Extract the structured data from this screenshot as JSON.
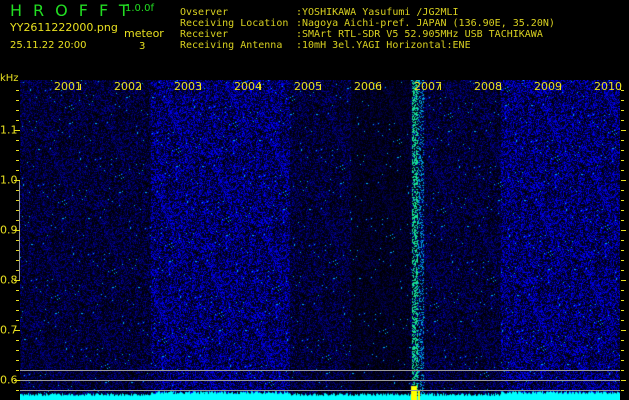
{
  "header": {
    "app_title": "HROFFT",
    "version": "1.0.0f",
    "filename": "YY2611222000.png",
    "datetime": "25.11.22 20:00",
    "meteor_label": "meteor",
    "meteor_count": "3"
  },
  "info": [
    {
      "key": "Ovserver",
      "value": ":YOSHIKAWA Yasufumi /JG2MLI"
    },
    {
      "key": "Receiving Location",
      "value": ":Nagoya Aichi-pref. JAPAN (136.90E, 35.20N)"
    },
    {
      "key": "Receiver",
      "value": ":SMArt RTL-SDR V5 52.905MHz USB TACHIKAWA"
    },
    {
      "key": "Receiving Antenna",
      "value": ":10mH 3el.YAGI Horizontal:ENE"
    }
  ],
  "spectrogram": {
    "y_unit": "kHz",
    "y_ticks": [
      "1.1",
      "1.0",
      "0.9",
      "0.8",
      "0.7",
      "0.6"
    ],
    "time_labels": [
      "2001",
      "2002",
      "2003",
      "2004",
      "2005",
      "2006",
      "2007",
      "2008",
      "2009",
      "2010"
    ],
    "colors": {
      "background": "#000000",
      "text": "#e8e020",
      "title": "#22dd22",
      "signal": "#00ffff",
      "noise": "#1a2ad0",
      "detection": "#ffff00"
    }
  }
}
